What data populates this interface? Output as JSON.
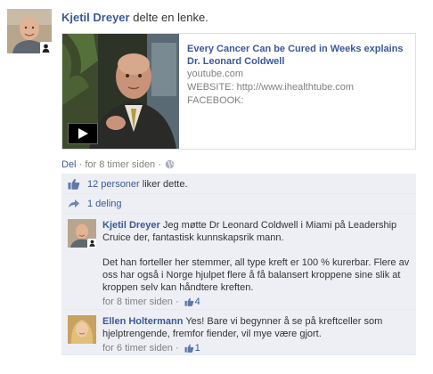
{
  "story": {
    "actor_name": "Kjetil Dreyer",
    "action_text": "delte en lenke."
  },
  "share": {
    "title": "Every Cancer Can be Cured in Weeks explains Dr. Leonard Coldwell",
    "source": "youtube.com",
    "line1": "WEBSITE: http://www.ihealthtube.com",
    "line2": "FACEBOOK:"
  },
  "actions": {
    "share_label": "Del",
    "separator": "·",
    "timestamp": "for 8 timer siden",
    "separator2": "·"
  },
  "ufi": {
    "likes_count_text": "12 personer",
    "likes_suffix": "liker dette.",
    "shares_text": "1 deling"
  },
  "comments": [
    {
      "author": "Kjetil Dreyer",
      "text_first": "Jeg møtte Dr Leonard Coldwell i Miami på Leadership Cruice der, fantastisk kunnskapsrik mann.",
      "text_second": "Det han forteller her stemmer, all type kreft er 100 % kurerbar. Flere av oss har også i Norge hjulpet flere å få balansert kroppene sine slik at kroppen selv kan håndtere kreften.",
      "timestamp": "for 8 timer siden",
      "separator": "·",
      "likes": "4"
    },
    {
      "author": "Ellen Holtermann",
      "text_first": "Yes! Bare vi begynner å se på kreftceller som hjelptrengende, fremfor fiender, vil mye være gjort.",
      "timestamp": "for 6 timer siden",
      "separator": "·",
      "likes": "1"
    }
  ],
  "colors": {
    "link_blue": "#3b5998",
    "ufi_background": "#edeff4",
    "meta_gray": "#808080"
  },
  "icons": [
    "user-badge-icon",
    "play-icon",
    "globe-icon",
    "like-thumb-icon",
    "share-icon"
  ]
}
